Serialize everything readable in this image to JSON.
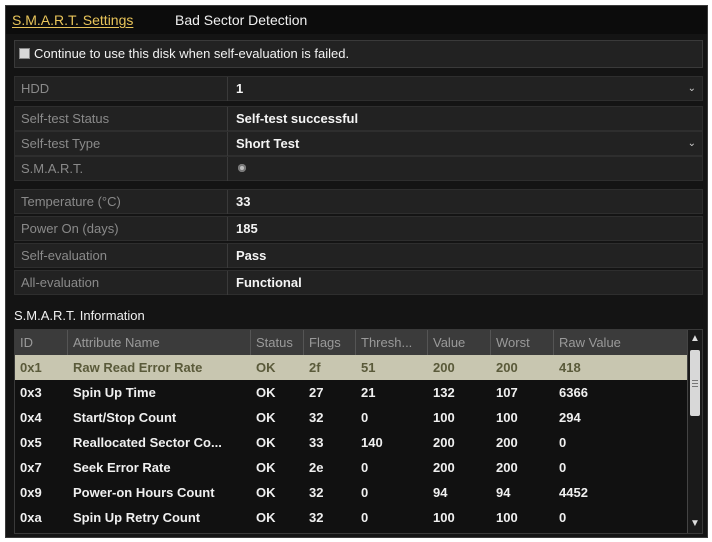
{
  "tabs": [
    {
      "label": "S.M.A.R.T. Settings",
      "active": true
    },
    {
      "label": "Bad Sector Detection",
      "active": false
    }
  ],
  "continue_checkbox": {
    "label": "Continue to use this disk when self-evaluation is failed.",
    "checked": false
  },
  "fields": {
    "hdd": {
      "label": "HDD",
      "value": "1"
    },
    "selftest_status": {
      "label": "Self-test Status",
      "value": "Self-test successful"
    },
    "selftest_type": {
      "label": "Self-test Type",
      "value": "Short Test"
    },
    "smart": {
      "label": "S.M.A.R.T.",
      "icon": "gear-icon"
    },
    "temperature": {
      "label": "Temperature (°C)",
      "value": "33"
    },
    "power_on": {
      "label": "Power On (days)",
      "value": "185"
    },
    "self_evaluation": {
      "label": "Self-evaluation",
      "value": "Pass"
    },
    "all_evaluation": {
      "label": "All-evaluation",
      "value": "Functional"
    }
  },
  "smart_info": {
    "title": "S.M.A.R.T. Information",
    "columns": [
      "ID",
      "Attribute Name",
      "Status",
      "Flags",
      "Thresh...",
      "Value",
      "Worst",
      "Raw Value"
    ],
    "rows": [
      [
        "0x1",
        "Raw Read Error Rate",
        "OK",
        "2f",
        "51",
        "200",
        "200",
        "418"
      ],
      [
        "0x3",
        "Spin Up Time",
        "OK",
        "27",
        "21",
        "132",
        "107",
        "6366"
      ],
      [
        "0x4",
        "Start/Stop Count",
        "OK",
        "32",
        "0",
        "100",
        "100",
        "294"
      ],
      [
        "0x5",
        "Reallocated Sector Co...",
        "OK",
        "33",
        "140",
        "200",
        "200",
        "0"
      ],
      [
        "0x7",
        "Seek Error Rate",
        "OK",
        "2e",
        "0",
        "200",
        "200",
        "0"
      ],
      [
        "0x9",
        "Power-on Hours Count",
        "OK",
        "32",
        "0",
        "94",
        "94",
        "4452"
      ],
      [
        "0xa",
        "Spin Up Retry Count",
        "OK",
        "32",
        "0",
        "100",
        "100",
        "0"
      ]
    ],
    "selected_row": 0
  },
  "colors": {
    "accent": "#e8c45a",
    "selected_row": "#c8c6b0",
    "background": "#141414"
  }
}
